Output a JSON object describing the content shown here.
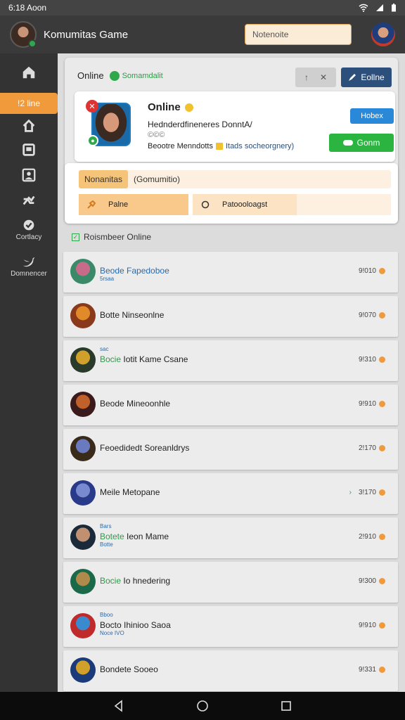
{
  "status": {
    "left_text": "6:18 Aoon"
  },
  "appbar": {
    "title": "Komumitas Game",
    "search_value": "Notenoite"
  },
  "sidebar": {
    "active_label": "!2 line",
    "items": [
      {
        "icon": "home-icon"
      },
      {
        "icon": "house-icon"
      },
      {
        "icon": "square-icon"
      },
      {
        "icon": "profile-icon"
      },
      {
        "icon": "share-icon"
      },
      {
        "icon": "chat-icon",
        "label": "Cortlacy"
      },
      {
        "icon": "bird-icon",
        "label": "Domnencer"
      }
    ]
  },
  "topcard": {
    "title": "Online",
    "status": "Somamdalit",
    "edit_label": "Eollne"
  },
  "profile": {
    "name": "Online",
    "line1": "Hednderdfineneres DonntA/",
    "line2": "©©©",
    "line3_a": "Beootre Menndotts",
    "line3_b": "Itads socheorgnery)",
    "btn_blue": "Hobex",
    "btn_green": "Gonm"
  },
  "filters": {
    "chip": "Nonanitas",
    "note": "(Gomumitio)",
    "btn_a": "Palne",
    "btn_b": "Patoooloagst"
  },
  "section": {
    "title": "Roismbeer Online"
  },
  "friends": [
    {
      "top": "",
      "name_colored": "Beode Fapedoboe",
      "name_plain": "",
      "sub": "5rsaa",
      "score": "9!010",
      "arrow": "",
      "colors": [
        "#c86a8a",
        "#3a8a6a"
      ]
    },
    {
      "top": "",
      "name_colored": "",
      "name_plain": "Botte Ninseonlne",
      "sub": "",
      "score": "9!070",
      "arrow": "",
      "colors": [
        "#e08a2a",
        "#8a3a1a"
      ]
    },
    {
      "top": "sac",
      "name_colored": "Bocie",
      "name_plain": "Iotit Kame Csane",
      "sub": "",
      "score": "9!310",
      "arrow": "",
      "colors": [
        "#d0a02a",
        "#2a3a2a"
      ]
    },
    {
      "top": "",
      "name_colored": "",
      "name_plain": "Beode Mineoonhle",
      "sub": "",
      "score": "9!910",
      "arrow": "",
      "colors": [
        "#c0602a",
        "#3a1a1a"
      ]
    },
    {
      "top": "",
      "name_colored": "",
      "name_plain": "Feoedidedt Soreanldrys",
      "sub": "",
      "score": "2!170",
      "arrow": "",
      "colors": [
        "#6a7ac0",
        "#3a2a1a"
      ]
    },
    {
      "top": "",
      "name_colored": "",
      "name_plain": "Meile Metopane",
      "sub": "",
      "score": "3!170",
      "arrow": "›",
      "colors": [
        "#7a8ad0",
        "#2a3a8a"
      ]
    },
    {
      "top": "Bars",
      "name_colored": "Botete",
      "name_plain": "Ieon Mame",
      "sub": "Botte",
      "score": "2!910",
      "arrow": "",
      "colors": [
        "#c09070",
        "#1a2a3a"
      ]
    },
    {
      "top": "",
      "name_colored": "Bocie",
      "name_plain": "Io hnedering",
      "sub": "",
      "score": "9!300",
      "arrow": "",
      "colors": [
        "#b08a4a",
        "#1a6a4a"
      ]
    },
    {
      "top": "Bboo",
      "name_colored": "",
      "name_plain": "Bocto Ihinioo Saoa",
      "sub": "Noce IVO",
      "score": "9!910",
      "arrow": "",
      "colors": [
        "#3a8ad0",
        "#c02a2a"
      ]
    },
    {
      "top": "",
      "name_colored": "",
      "name_plain": "Bondete Sooeo",
      "sub": "",
      "score": "9!331",
      "arrow": "",
      "colors": [
        "#d0a02a",
        "#1a3a7a"
      ]
    }
  ],
  "colors": {
    "accent": "#f09a3c",
    "primary_blue": "#2c4f7c",
    "online_green": "#2ea84a"
  }
}
